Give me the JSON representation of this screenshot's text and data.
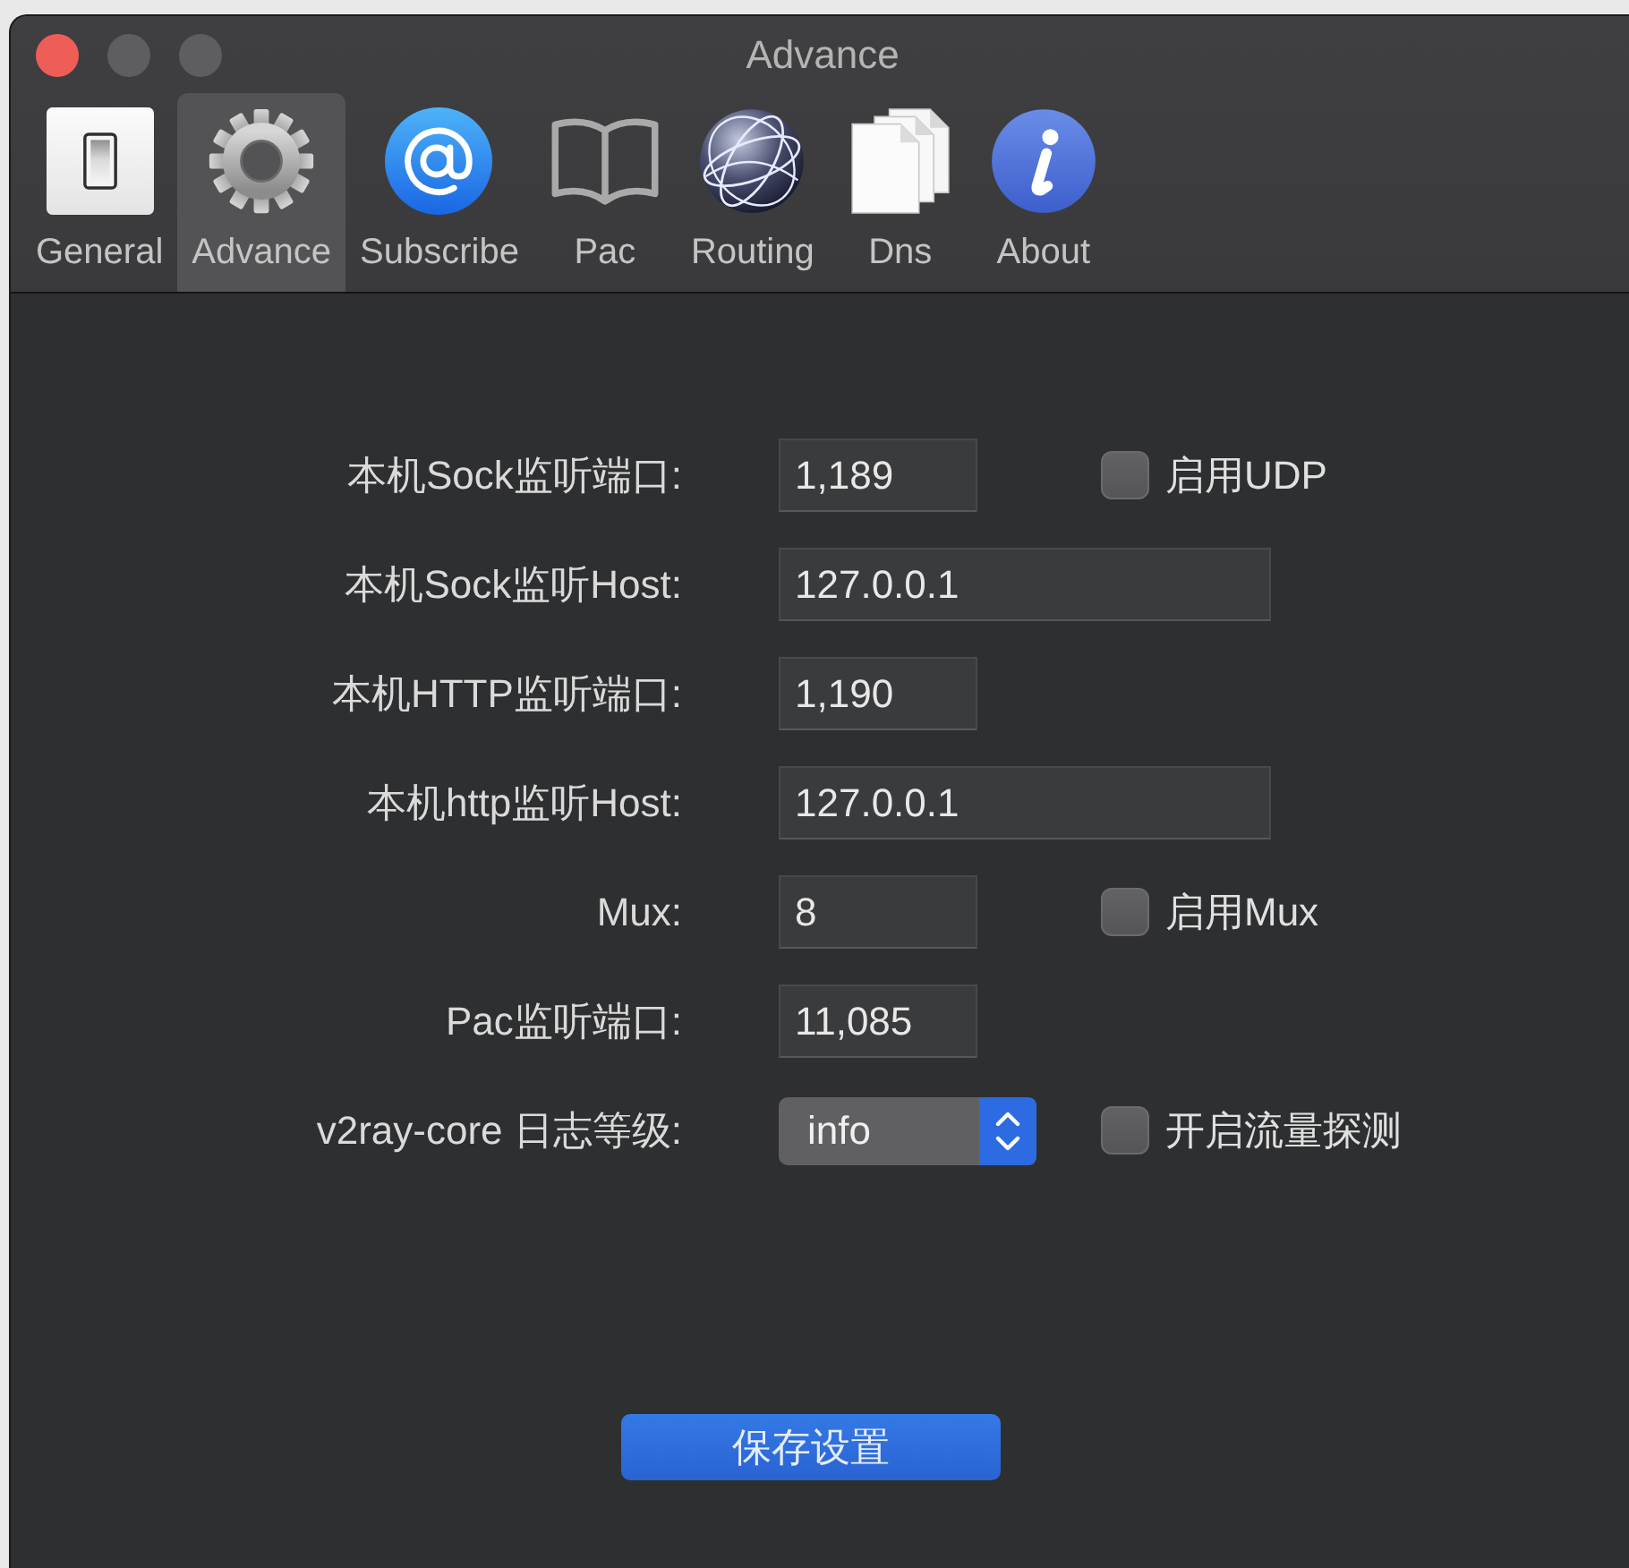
{
  "window": {
    "title": "Advance",
    "controls": [
      {
        "kind": "close",
        "disabled": false
      },
      {
        "kind": "minimize",
        "disabled": true
      },
      {
        "kind": "zoom",
        "disabled": true
      }
    ]
  },
  "toolbar": [
    {
      "label": "General",
      "kind": "switch",
      "selected": false
    },
    {
      "label": "Advance",
      "kind": "gear",
      "selected": true
    },
    {
      "label": "Subscribe",
      "kind": "at",
      "selected": false
    },
    {
      "label": "Pac",
      "kind": "book",
      "selected": false
    },
    {
      "label": "Routing",
      "kind": "globe",
      "selected": false
    },
    {
      "label": "Dns",
      "kind": "documents",
      "selected": false
    },
    {
      "label": "About",
      "kind": "info",
      "selected": false
    }
  ],
  "form": [
    {
      "label": "本机Sock监听端口:",
      "kind": "number",
      "value": "1,189",
      "checkbox": {
        "label": "启用UDP",
        "checked": false
      }
    },
    {
      "label": "本机Sock监听Host:",
      "kind": "text",
      "value": "127.0.0.1"
    },
    {
      "label": "本机HTTP监听端口:",
      "kind": "number",
      "value": "1,190"
    },
    {
      "label": "本机http监听Host:",
      "kind": "text",
      "value": "127.0.0.1"
    },
    {
      "label": "Mux:",
      "kind": "number",
      "value": "8",
      "checkbox": {
        "label": "启用Mux",
        "checked": false
      }
    },
    {
      "label": "Pac监听端口:",
      "kind": "number",
      "value": "11,085"
    },
    {
      "label": "v2ray-core 日志等级:",
      "kind": "select",
      "value": "info",
      "checkbox": {
        "label": "开启流量探测",
        "checked": false
      }
    }
  ],
  "save_button": {
    "label": "保存设置"
  }
}
